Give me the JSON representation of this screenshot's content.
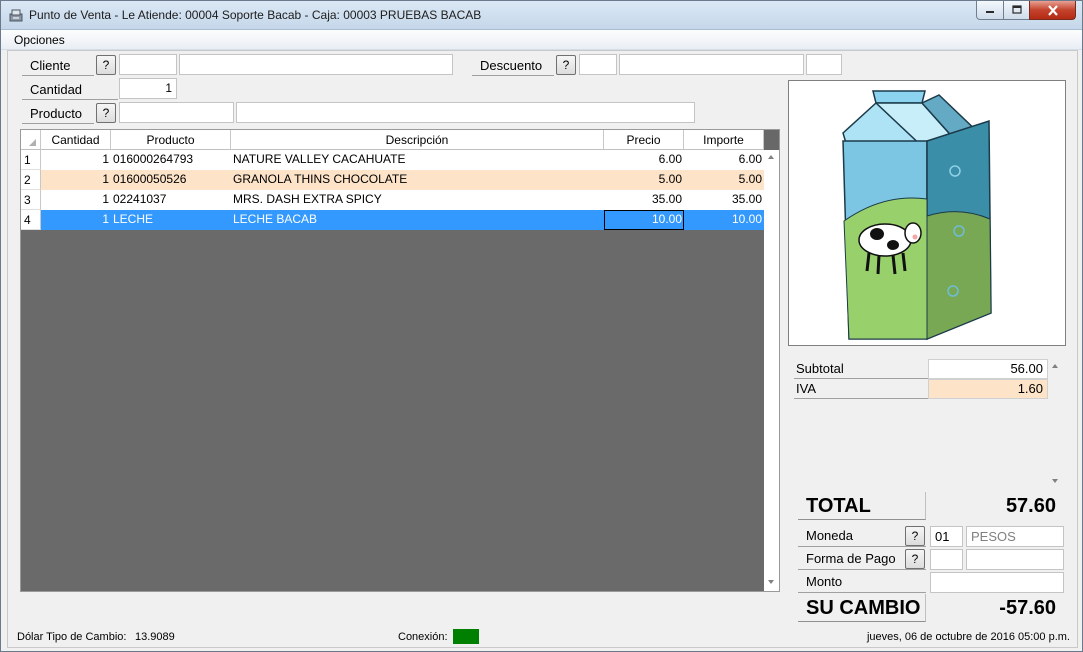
{
  "window": {
    "title": "Punto de Venta - Le Atiende: 00004 Soporte Bacab - Caja: 00003 PRUEBAS BACAB"
  },
  "menu": {
    "opciones": "Opciones"
  },
  "form": {
    "cliente_label": "Cliente",
    "descuento_label": "Descuento",
    "cantidad_label": "Cantidad",
    "cantidad_value": "1",
    "producto_label": "Producto",
    "help_label": "?"
  },
  "grid": {
    "columns": [
      "Cantidad",
      "Producto",
      "Descripción",
      "Precio",
      "Importe"
    ],
    "rows": [
      {
        "n": "1",
        "cantidad": "1",
        "producto": "016000264793",
        "descripcion": "NATURE  VALLEY CACAHUATE",
        "precio": "6.00",
        "importe": "6.00"
      },
      {
        "n": "2",
        "cantidad": "1",
        "producto": "01600050526",
        "descripcion": "GRANOLA THINS CHOCOLATE",
        "precio": "5.00",
        "importe": "5.00"
      },
      {
        "n": "3",
        "cantidad": "1",
        "producto": "02241037",
        "descripcion": "MRS. DASH EXTRA SPICY",
        "precio": "35.00",
        "importe": "35.00"
      },
      {
        "n": "4",
        "cantidad": "1",
        "producto": "LECHE",
        "descripcion": "LECHE BACAB",
        "precio": "10.00",
        "importe": "10.00"
      }
    ],
    "selected_row": 4
  },
  "totals": {
    "subtotal_label": "Subtotal",
    "subtotal_value": "56.00",
    "iva_label": "IVA",
    "iva_value": "1.60",
    "total_label": "TOTAL",
    "total_value": "57.60",
    "moneda_label": "Moneda",
    "moneda_code": "01",
    "moneda_name": "PESOS",
    "forma_pago_label": "Forma de Pago",
    "monto_label": "Monto",
    "cambio_label": "SU CAMBIO",
    "cambio_value": "-57.60"
  },
  "status": {
    "dolar_label": "Dólar Tipo de Cambio:",
    "dolar_value": "13.9089",
    "conexion_label": "Conexión:",
    "datetime": "jueves, 06 de octubre de 2016 05:00 p.m."
  },
  "colors": {
    "alt_row": "#fde3c8",
    "selected_row": "#3399ff",
    "grid_empty": "#6a6a6a",
    "conexion_ok": "#008000"
  }
}
